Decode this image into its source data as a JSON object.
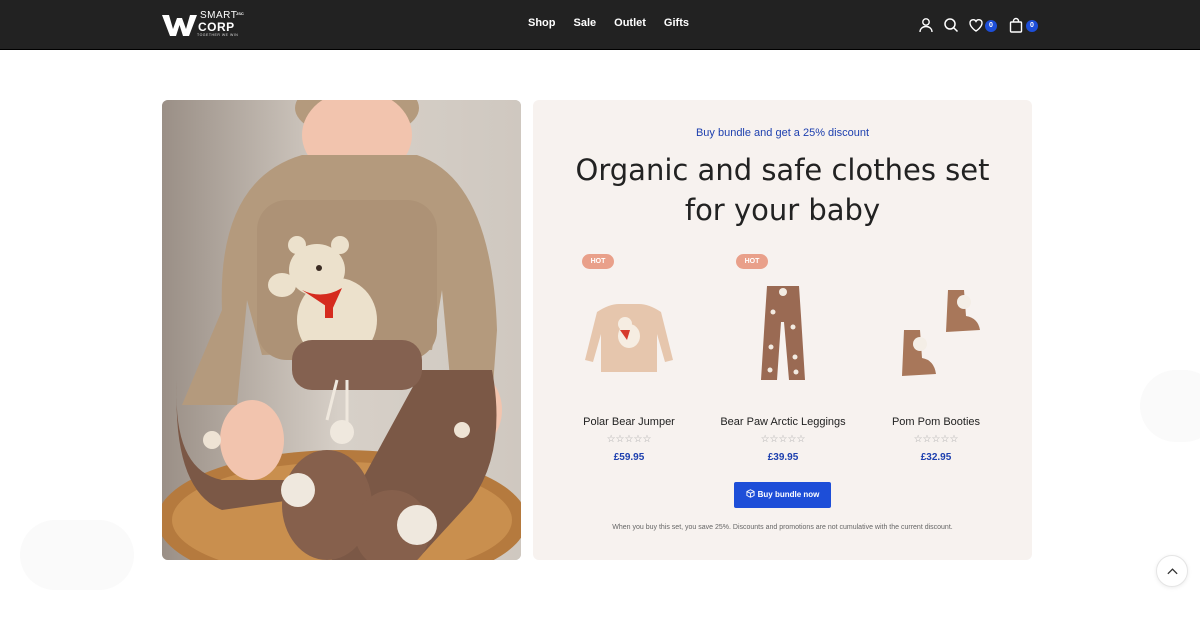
{
  "logo": {
    "line1": "SMART",
    "line2": "CORP",
    "superscript": "JSC",
    "tagline": "TOGETHER WE WIN",
    "icon": "w-logo-icon"
  },
  "nav": {
    "items": [
      "Shop",
      "Sale",
      "Outlet",
      "Gifts"
    ]
  },
  "header_icons": {
    "account": "user-icon",
    "search": "search-icon",
    "wishlist": "heart-icon",
    "wishlist_count": "0",
    "cart": "bag-icon",
    "cart_count": "0"
  },
  "bundle": {
    "eyebrow": "Buy bundle and get a 25% discount",
    "title": "Organic and safe clothes set for your baby",
    "products": [
      {
        "badge": "HOT",
        "name": "Polar Bear Jumper",
        "stars": "☆☆☆☆☆",
        "price": "£59.95"
      },
      {
        "badge": "HOT",
        "name": "Bear Paw Arctic Leggings",
        "stars": "☆☆☆☆☆",
        "price": "£39.95"
      },
      {
        "badge": "",
        "name": "Pom Pom Booties",
        "stars": "☆☆☆☆☆",
        "price": "£32.95"
      }
    ],
    "button_label": "Buy bundle now",
    "button_icon": "package-icon",
    "note": "When you buy this set, you save 25%. Discounts and promotions are not cumulative with the current discount."
  },
  "colors": {
    "header_bg": "#222222",
    "accent": "#1d4ed8",
    "hot_badge": "#e9a08a",
    "panel_bg": "#f7f2ef"
  },
  "scroll_top_icon": "chevron-up-icon"
}
